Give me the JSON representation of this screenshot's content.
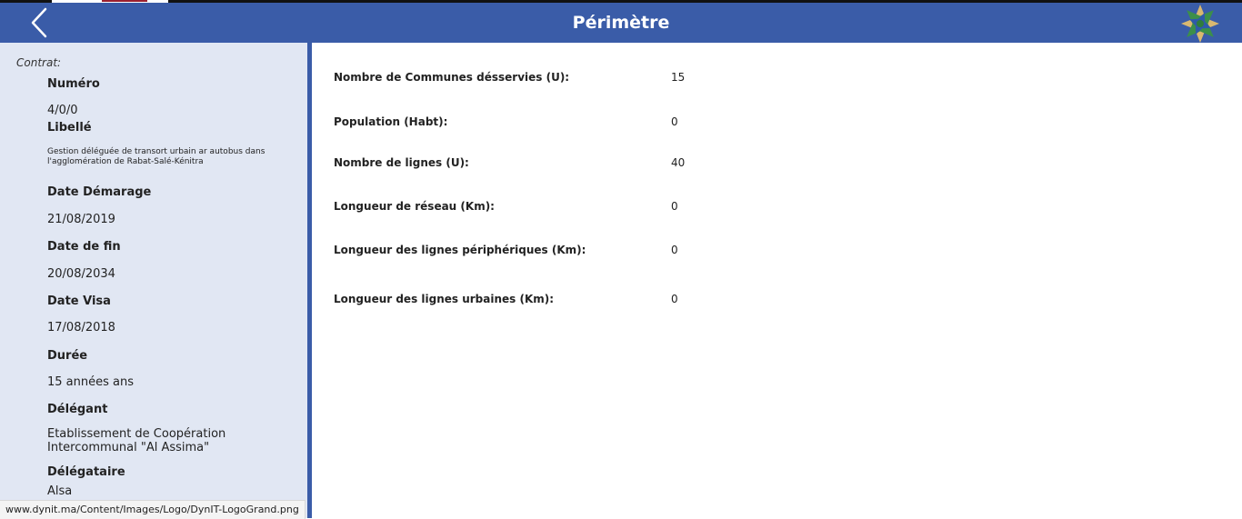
{
  "header": {
    "title": "Périmètre",
    "back_icon": "chevron-left-icon",
    "logo_icon": "star-emblem-logo"
  },
  "colors": {
    "header": "#3a5ca8",
    "sidebar": "#e1e7f3",
    "divider": "#3a5ca8"
  },
  "sidebar": {
    "heading": "Contrat:",
    "fields": [
      {
        "label": "Numéro",
        "value": "4/0/0"
      },
      {
        "label": "Libellé",
        "value": "Gestion déléguée de transort urbain ar autobus dans l'agglomération de Rabat-Salé-Kénitra"
      },
      {
        "label": "Date Démarage",
        "value": "21/08/2019"
      },
      {
        "label": "Date de fin",
        "value": "20/08/2034"
      },
      {
        "label": "Date Visa",
        "value": "17/08/2018"
      },
      {
        "label": "Durée",
        "value": "15 années ans"
      },
      {
        "label": "Délégant",
        "value": "Etablissement de Coopération Intercommunal \"Al Assima\""
      },
      {
        "label": "Délégataire",
        "value": "Alsa"
      }
    ]
  },
  "statusbar": {
    "url": "www.dynit.ma/Content/Images/Logo/DynIT-LogoGrand.png"
  },
  "main": {
    "rows": [
      {
        "label": "Nombre de Communes désservies (U):",
        "value": "15"
      },
      {
        "label": "Population (Habt):",
        "value": "0"
      },
      {
        "label": "Nombre de lignes (U):",
        "value": "40"
      },
      {
        "label": "Longueur de réseau (Km):",
        "value": "0"
      },
      {
        "label": "Longueur des lignes périphériques (Km):",
        "value": "0"
      },
      {
        "label": "Longueur des lignes urbaines (Km):",
        "value": "0"
      }
    ]
  }
}
